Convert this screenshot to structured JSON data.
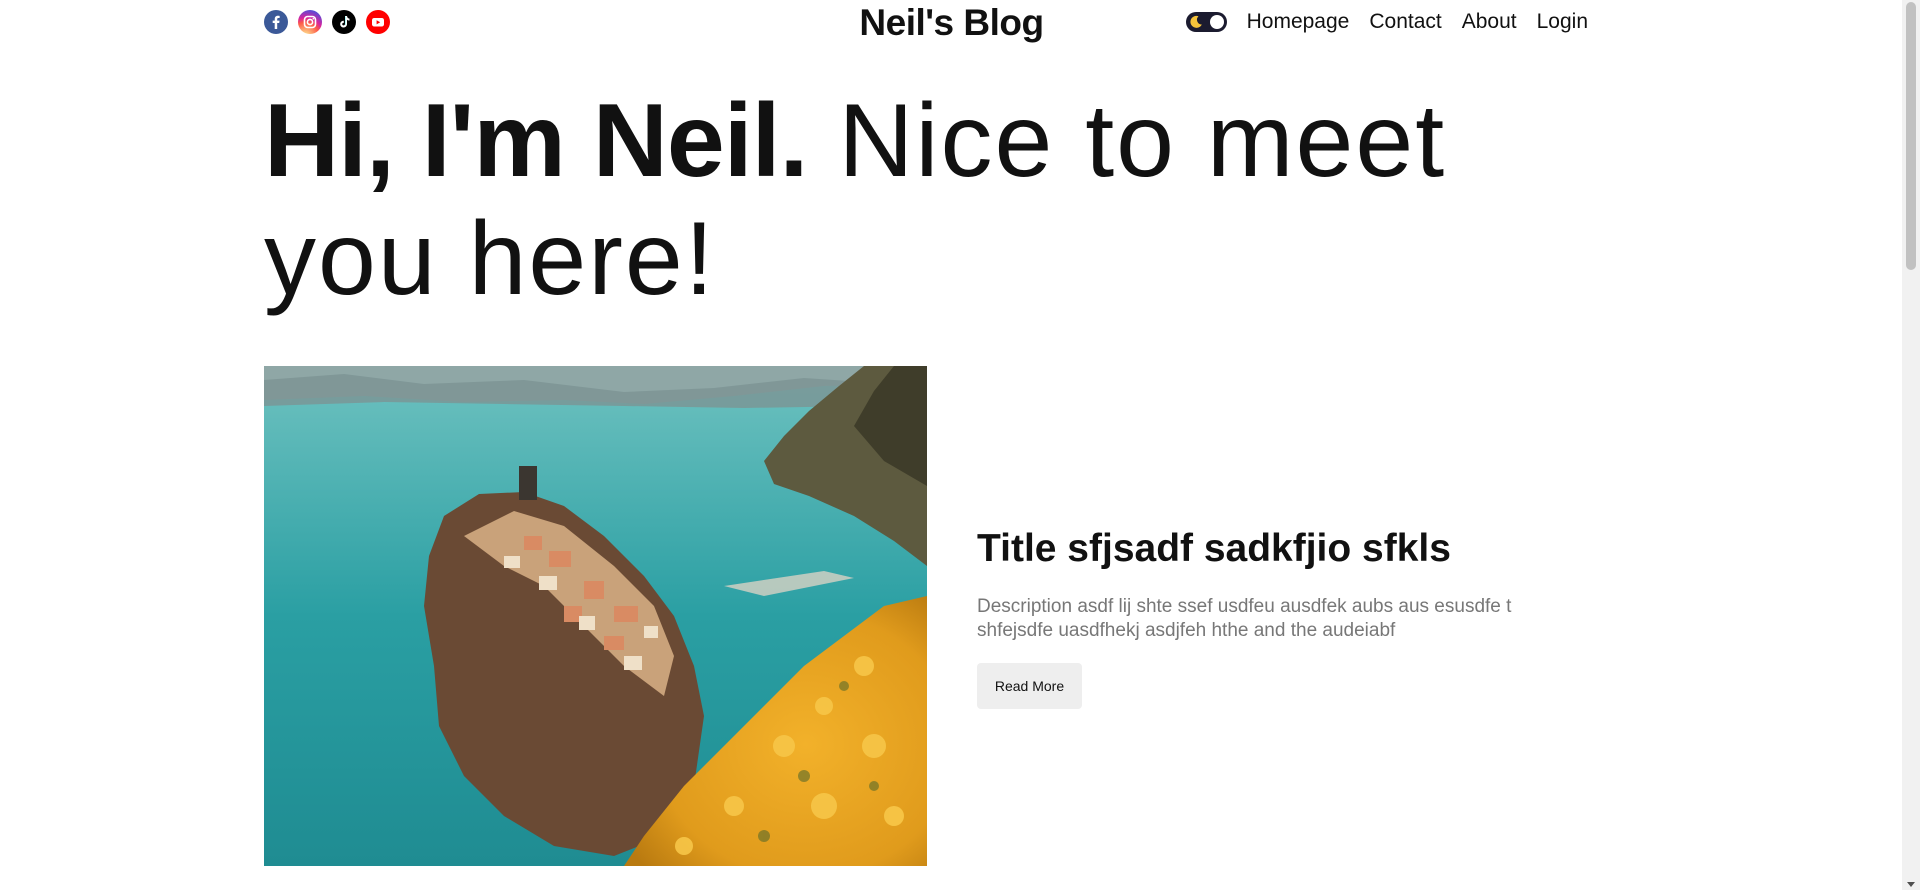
{
  "header": {
    "brand": "Neil's Blog",
    "socials": [
      {
        "name": "facebook-icon"
      },
      {
        "name": "instagram-icon"
      },
      {
        "name": "tiktok-icon"
      },
      {
        "name": "youtube-icon"
      }
    ],
    "theme_toggle": {
      "state": "dark",
      "icon": "moon-icon"
    },
    "nav": [
      "Homepage",
      "Contact",
      "About",
      "Login"
    ]
  },
  "hero": {
    "strong": "Hi, I'm Neil.",
    "rest": " Nice to meet you here!"
  },
  "featured_post": {
    "image_alt": "coastal cliff town with yellow flowers",
    "title": "Title sfjsadf sadkfjio sfkls",
    "description": "Description asdf lij shte ssef usdfeu ausdfek aubs aus esusdfe t shfejsdfe uasdfhekj asdjfeh hthe and the audeiabf",
    "read_more": "Read More"
  },
  "colors": {
    "text": "#111111",
    "muted": "#777777",
    "button_bg": "#eeeeee",
    "toggle_bg": "#1b1b2f",
    "moon": "#f5c33b"
  }
}
